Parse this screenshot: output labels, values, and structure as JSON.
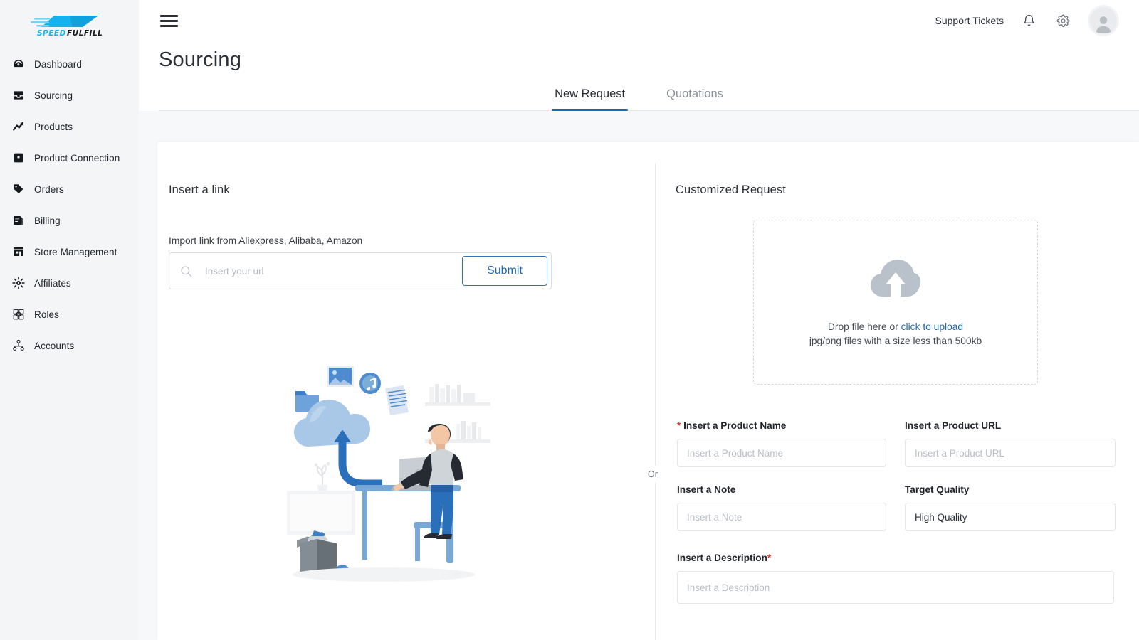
{
  "brand": {
    "logo_text_1": "SPEED",
    "logo_text_2": "FULFILL",
    "logo_color": "#15b2ef"
  },
  "sidebar": {
    "items": [
      {
        "label": "Dashboard",
        "icon": "dashboard-icon"
      },
      {
        "label": "Sourcing",
        "icon": "inbox-icon"
      },
      {
        "label": "Products",
        "icon": "trending-up-icon"
      },
      {
        "label": "Product Connection",
        "icon": "box-icon"
      },
      {
        "label": "Orders",
        "icon": "tag-icon"
      },
      {
        "label": "Billing",
        "icon": "documents-icon"
      },
      {
        "label": "Store Management",
        "icon": "storefront-icon"
      },
      {
        "label": "Affiliates",
        "icon": "sun-network-icon"
      },
      {
        "label": "Roles",
        "icon": "roles-icon"
      },
      {
        "label": "Accounts",
        "icon": "org-chart-icon"
      }
    ]
  },
  "topbar": {
    "menu_icon": "hamburger-icon",
    "support_label": "Support Tickets",
    "bell_icon": "notification-bell-icon",
    "settings_icon": "gear-icon",
    "avatar_icon": "user-avatar-icon"
  },
  "page": {
    "title": "Sourcing",
    "tabs": [
      {
        "label": "New Request",
        "active": true
      },
      {
        "label": "Quotations",
        "active": false
      }
    ]
  },
  "insert_link": {
    "title": "Insert a link",
    "sub_label": "Import link from Aliexpress, Alibaba, Amazon",
    "search_icon": "search-icon",
    "input_value": "",
    "input_placeholder": "Insert your url",
    "submit_label": "Submit",
    "illustration": "cloud-upload-illustration"
  },
  "divider": {
    "or_label": "Or"
  },
  "customized": {
    "title": "Customized Request",
    "upload": {
      "icon": "cloud-upload-icon",
      "line1_prefix": "Drop file here or ",
      "line1_link": "click to upload",
      "line2": "jpg/png files with a size less than 500kb"
    },
    "fields": {
      "product_name": {
        "label": "Insert a Product Name",
        "required": true,
        "required_prefix": true,
        "value": "",
        "placeholder": "Insert a Product Name"
      },
      "product_url": {
        "label": "Insert a Product URL",
        "required": false,
        "value": "",
        "placeholder": "Insert a Product URL"
      },
      "note": {
        "label": "Insert a Note",
        "required": false,
        "value": "",
        "placeholder": "Insert a Note"
      },
      "target_quality": {
        "label": "Target Quality",
        "required": false,
        "value": "High Quality",
        "placeholder": "High Quality"
      },
      "description": {
        "label": "Insert a Description",
        "required": true,
        "required_suffix": true,
        "value": "",
        "placeholder": "Insert a Description"
      }
    }
  },
  "colors": {
    "accent_blue": "#1668b3",
    "link_blue": "#2069b0",
    "required_red": "#e8342a",
    "sidebar_bg": "#f4f5f7",
    "page_bg": "#f7f8f9"
  }
}
